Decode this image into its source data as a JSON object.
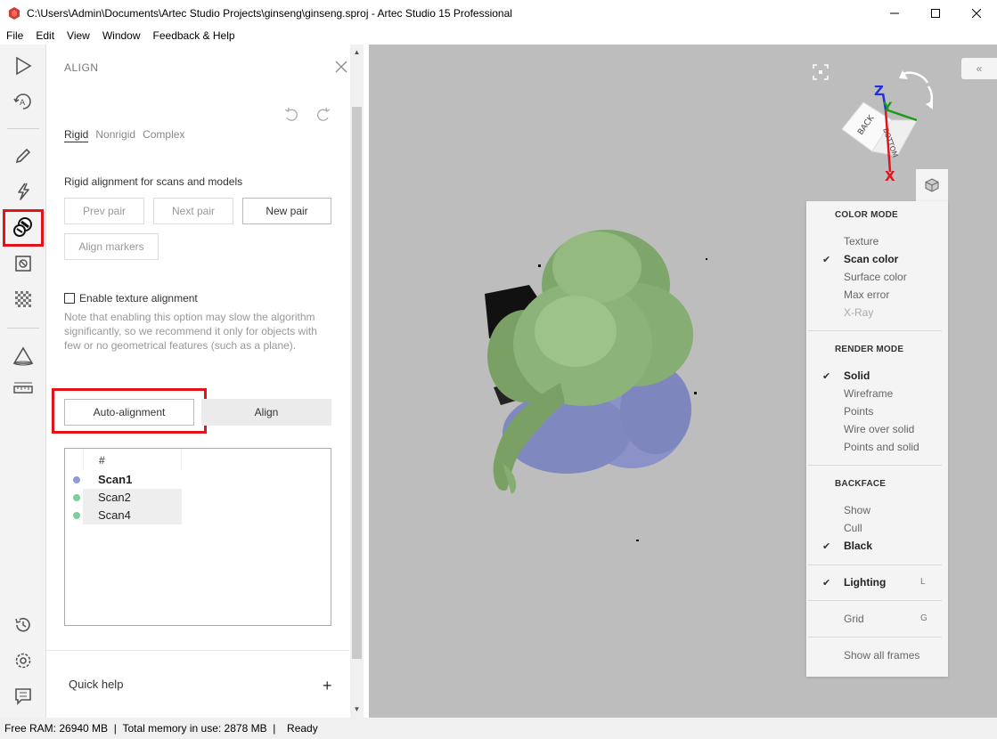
{
  "window": {
    "title": "C:\\Users\\Admin\\Documents\\Artec Studio Projects\\ginseng\\ginseng.sproj - Artec Studio 15 Professional",
    "minimize_icon": "minimize-icon",
    "maximize_icon": "maximize-icon",
    "close_icon": "close-icon"
  },
  "menu": [
    "File",
    "Edit",
    "View",
    "Window",
    "Feedback & Help"
  ],
  "toolbar": {
    "items": [
      "play-icon",
      "autopilot-icon",
      "edit-icon",
      "tools-icon",
      "align-icon",
      "fusion-icon",
      "texture-icon",
      "measure-icon",
      "ruler-icon",
      "history-icon",
      "settings-icon",
      "feedback-icon"
    ],
    "active": "align-icon"
  },
  "panel": {
    "title": "ALIGN",
    "tabs": [
      "Rigid",
      "Nonrigid",
      "Complex"
    ],
    "active_tab": "Rigid",
    "description": "Rigid alignment for scans and models",
    "prev_pair": "Prev pair",
    "next_pair": "Next pair",
    "new_pair": "New pair",
    "align_markers": "Align markers",
    "texture_checkbox": "Enable texture alignment",
    "texture_checked": false,
    "note": "Note that enabling this option may slow the algorithm significantly, so we recommend it only for objects with few or no geometrical features (such as a plane).",
    "auto_alignment": "Auto-alignment",
    "align": "Align",
    "table_header": "#",
    "scans": [
      {
        "name": "Scan1",
        "color": "#8f9be0",
        "bold": true
      },
      {
        "name": "Scan2",
        "color": "#7fcf9a",
        "bold": false
      },
      {
        "name": "Scan4",
        "color": "#7fcf9a",
        "bold": false
      }
    ],
    "quick_help": "Quick help",
    "quick_help_toggle": "+"
  },
  "display_menu": {
    "color_mode": {
      "heading": "COLOR MODE",
      "items": [
        {
          "label": "Texture",
          "checked": false,
          "disabled": false
        },
        {
          "label": "Scan color",
          "checked": true,
          "disabled": false
        },
        {
          "label": "Surface color",
          "checked": false,
          "disabled": false
        },
        {
          "label": "Max error",
          "checked": false,
          "disabled": false
        },
        {
          "label": "X-Ray",
          "checked": false,
          "disabled": true
        }
      ]
    },
    "render_mode": {
      "heading": "RENDER MODE",
      "items": [
        {
          "label": "Solid",
          "checked": true
        },
        {
          "label": "Wireframe",
          "checked": false
        },
        {
          "label": "Points",
          "checked": false
        },
        {
          "label": "Wire over solid",
          "checked": false
        },
        {
          "label": "Points and solid",
          "checked": false
        }
      ]
    },
    "backface": {
      "heading": "BACKFACE",
      "items": [
        {
          "label": "Show",
          "checked": false
        },
        {
          "label": "Cull",
          "checked": false
        },
        {
          "label": "Black",
          "checked": true
        }
      ]
    },
    "lighting": {
      "label": "Lighting",
      "key": "L",
      "checked": true
    },
    "grid": {
      "label": "Grid",
      "key": "G",
      "checked": false
    },
    "show_all_frames": "Show all frames"
  },
  "viewcube": {
    "labels": [
      "BACK",
      "BOTTOM"
    ],
    "axes": [
      "Z",
      "Y",
      "X"
    ]
  },
  "status": {
    "free_ram": "Free RAM: 26940 MB",
    "sep1": "  |  ",
    "total_memory": "Total memory in use: 2878 MB",
    "sep2": "  |  ",
    "state": "Ready"
  },
  "colors": {
    "highlight": "#e2131a",
    "scan_green": "#7fa86a",
    "scan_blue": "#8a92c8",
    "viewport_bg": "#bdbdbd"
  }
}
